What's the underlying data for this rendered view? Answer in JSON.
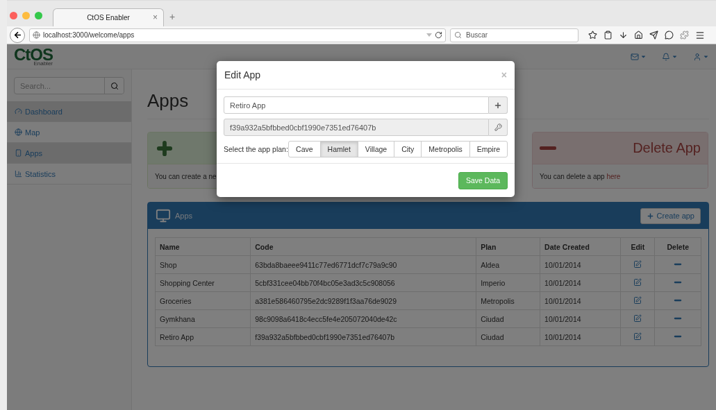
{
  "browser": {
    "tab": {
      "title": "CtOS Enabler",
      "close": "×"
    },
    "new_tab": "+",
    "url": "localhost:3000/welcome/apps",
    "search": {
      "placeholder": "Buscar"
    }
  },
  "navbar": {
    "brand": "CtOS",
    "brand_sub": "Enabler"
  },
  "sidebar": {
    "search": {
      "placeholder": "Search..."
    },
    "items": [
      {
        "label": "Dashboard",
        "kind": "dashboard",
        "shaded": true
      },
      {
        "label": "Map",
        "kind": "map",
        "shaded": false
      },
      {
        "label": "Apps",
        "kind": "apps",
        "shaded": true
      },
      {
        "label": "Statistics",
        "kind": "statistics",
        "shaded": false
      }
    ]
  },
  "page": {
    "title": "Apps",
    "create_panel": {
      "body": "You can create a ne"
    },
    "delete_panel": {
      "title": "Delete App",
      "body": "You can delete a app ",
      "link": "here"
    },
    "apps_panel": {
      "title": "Apps",
      "create_button": "Create app",
      "table": {
        "columns": [
          "Name",
          "Code",
          "Plan",
          "Date Created",
          "Edit",
          "Delete"
        ],
        "rows": [
          {
            "name": "Shop",
            "code": "63bda8baeee9411c77ed6771dcf7c79a9c90",
            "plan": "Aldea",
            "date": "10/01/2014"
          },
          {
            "name": "Shopping Center",
            "code": "5cbf331cee04bb70f4bc05e3ad3c5c908056",
            "plan": "Imperio",
            "date": "10/01/2014"
          },
          {
            "name": "Groceries",
            "code": "a381e586460795e2dc9289f1f3aa76de9029",
            "plan": "Metropolis",
            "date": "10/01/2014"
          },
          {
            "name": "Gymkhana",
            "code": "98c9098a6418c4ecc5fe4e205072040de42c",
            "plan": "Ciudad",
            "date": "10/01/2014"
          },
          {
            "name": "Retiro App",
            "code": "f39a932a5bfbbed0cbf1990e7351ed76407b",
            "plan": "Ciudad",
            "date": "10/01/2014"
          }
        ]
      }
    }
  },
  "modal": {
    "title": "Edit App",
    "close": "×",
    "name_value": "Retiro App",
    "code_value": "f39a932a5bfbbed0cbf1990e7351ed76407b",
    "plan_label": "Select the app plan:",
    "plans": [
      {
        "label": "Cave",
        "selected": false
      },
      {
        "label": "Hamlet",
        "selected": true
      },
      {
        "label": "Village",
        "selected": false
      },
      {
        "label": "City",
        "selected": false
      },
      {
        "label": "Metropolis",
        "selected": false
      },
      {
        "label": "Empire",
        "selected": false
      }
    ],
    "save": "Save Data"
  }
}
